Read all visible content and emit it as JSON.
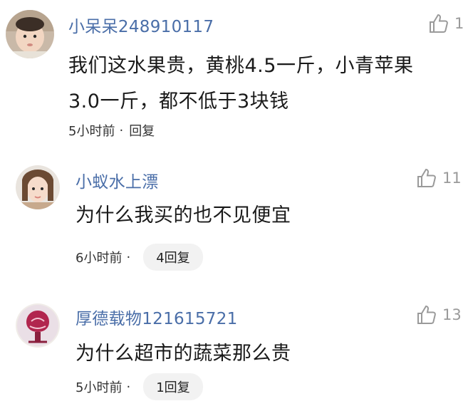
{
  "comments": [
    {
      "username": "小呆呆248910117",
      "likes": "1",
      "content_lines": [
        "我们这水果贵，黄桃4.5一斤，小青苹果",
        "3.0一斤，都不低于3块钱"
      ],
      "time": "5小时前",
      "separator": "·",
      "reply_label": "回复"
    },
    {
      "username": "小蚁水上漂",
      "likes": "11",
      "content_lines": [
        "为什么我买的也不见便宜"
      ],
      "time": "6小时前",
      "separator": "·",
      "reply_label": "4回复"
    },
    {
      "username": "厚德载物121615721",
      "likes": "13",
      "content_lines": [
        "为什么超市的蔬菜那么贵"
      ],
      "time": "5小时前",
      "separator": "·",
      "reply_label": "1回复"
    }
  ],
  "colors": {
    "username": "#4a6ea8",
    "meta": "#333333",
    "pill_bg": "#f2f2f2",
    "like_icon": "#9a9a9a"
  },
  "icons": {
    "like": "thumbs-up-icon"
  }
}
